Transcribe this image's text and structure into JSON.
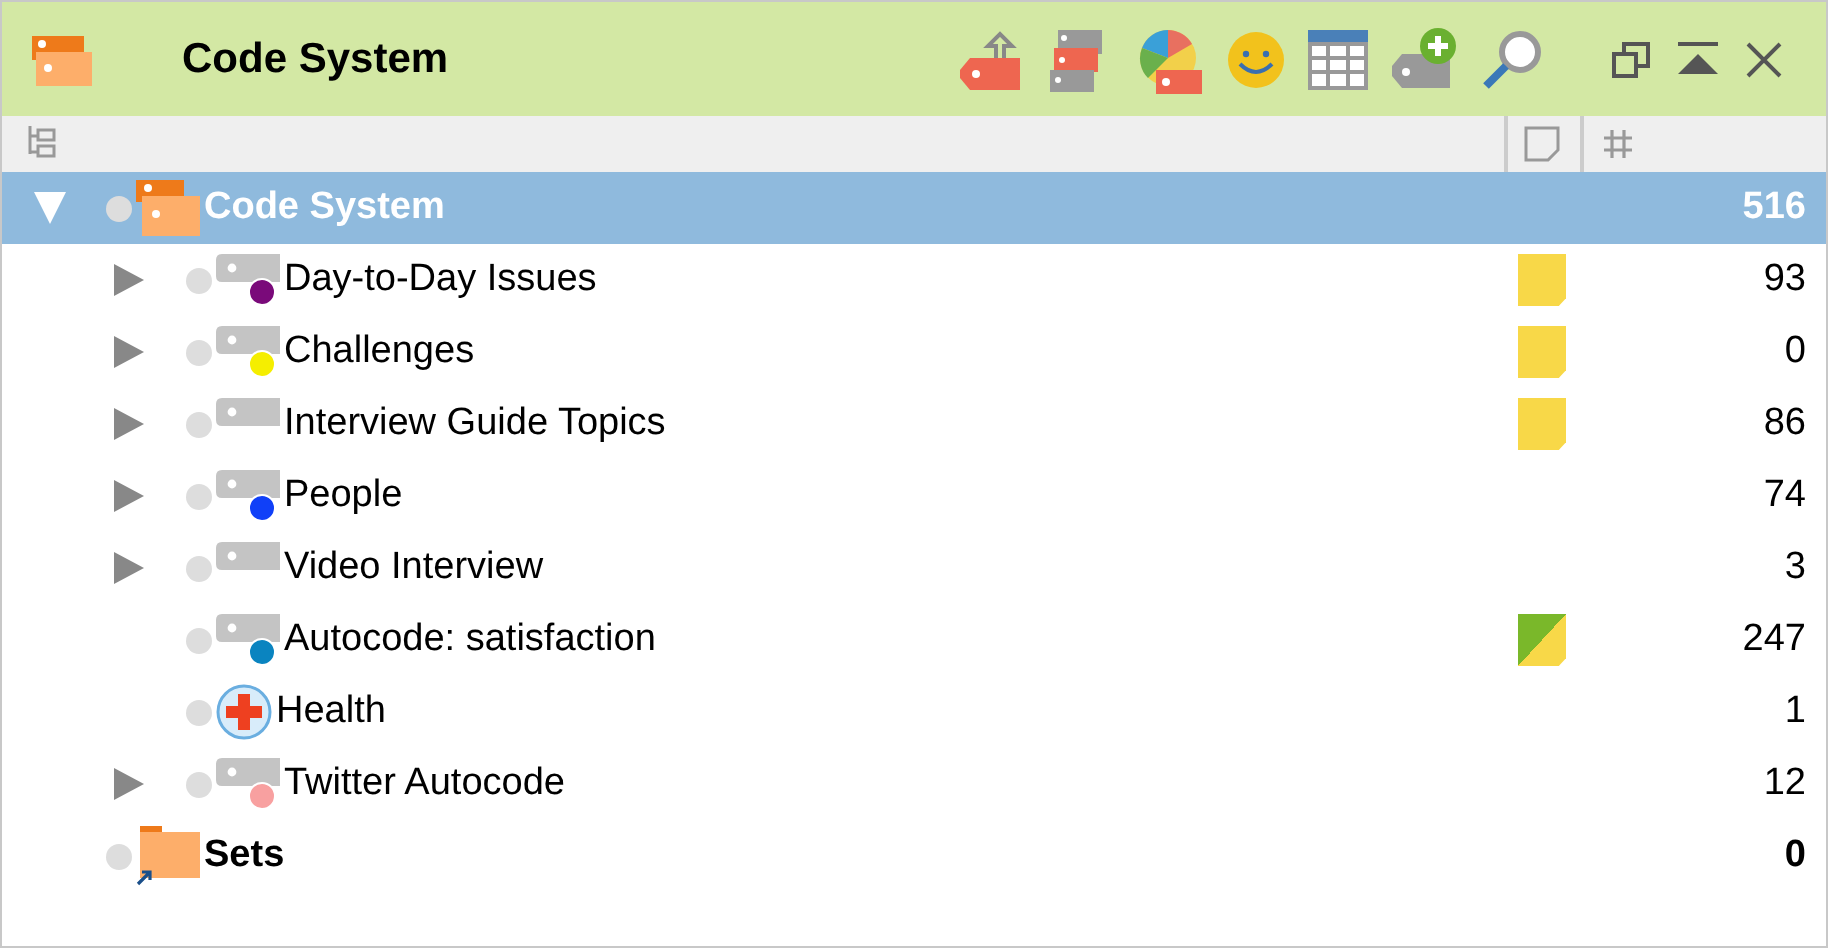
{
  "window": {
    "title": "Code System"
  },
  "tree": [
    {
      "label": "Code System",
      "count": "516",
      "selected": true,
      "expanded": true,
      "kind": "system",
      "children": [
        {
          "label": "Day-to-Day Issues",
          "count": "93",
          "selected": false,
          "expanded": false,
          "kind": "code",
          "color": "#7a0a7a",
          "memo": {
            "kind": "plain"
          }
        },
        {
          "label": "Challenges",
          "count": "0",
          "selected": false,
          "expanded": false,
          "kind": "code",
          "color": "#f5ee00",
          "memo": {
            "kind": "plain"
          }
        },
        {
          "label": "Interview Guide Topics",
          "count": "86",
          "selected": false,
          "expanded": false,
          "kind": "code",
          "memo": {
            "kind": "plain"
          }
        },
        {
          "label": "People",
          "count": "74",
          "selected": false,
          "expanded": false,
          "kind": "code",
          "color": "#1040f8"
        },
        {
          "label": "Video Interview",
          "count": "3",
          "selected": false,
          "expanded": false,
          "kind": "code"
        },
        {
          "label": "Autocode: satisfaction",
          "count": "247",
          "selected": false,
          "kind": "code",
          "color": "#0a84c0",
          "memo": {
            "kind": "autocode"
          }
        },
        {
          "label": "Health",
          "count": "1",
          "selected": false,
          "kind": "health"
        },
        {
          "label": "Twitter Autocode",
          "count": "12",
          "selected": false,
          "expanded": false,
          "kind": "code",
          "color": "#f8a0a0"
        }
      ]
    },
    {
      "label": "Sets",
      "count": "0",
      "selected": false,
      "kind": "sets"
    }
  ]
}
